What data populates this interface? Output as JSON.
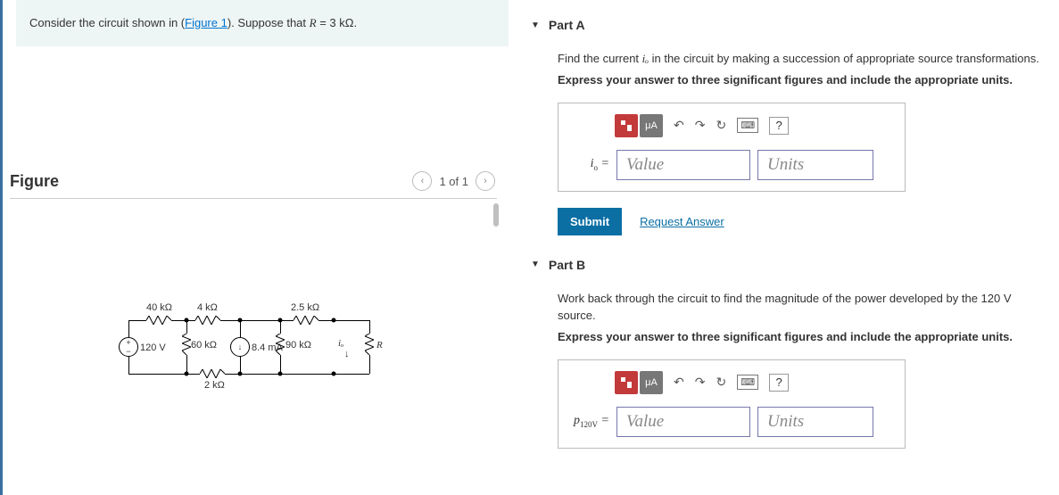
{
  "prompt": {
    "pre": "Consider the circuit shown in (",
    "link": "Figure 1",
    "post": "). Suppose that ",
    "var": "R",
    "eq": " = 3 kΩ."
  },
  "figure": {
    "heading": "Figure",
    "pager": "1 of 1",
    "labels": {
      "r40": "40 kΩ",
      "r4": "4 kΩ",
      "r25": "2.5 kΩ",
      "v120": "120 V",
      "r60": "60 kΩ",
      "i84": "8.4 mA",
      "r90": "90 kΩ",
      "r2": "2 kΩ",
      "io": "iₒ",
      "R": "R"
    }
  },
  "partA": {
    "title": "Part A",
    "line1_pre": "Find the current ",
    "line1_var": "iₒ",
    "line1_post": " in the circuit by making a succession of appropriate source transformations.",
    "line2": "Express your answer to three significant figures and include the appropriate units.",
    "toolbar_unit": "μA",
    "eq_label_html": "iₒ =",
    "value_ph": "Value",
    "units_ph": "Units",
    "submit": "Submit",
    "request": "Request Answer",
    "help": "?"
  },
  "partB": {
    "title": "Part B",
    "line1": "Work back through the circuit to find the magnitude of the power developed by the 120 V source.",
    "line2": "Express your answer to three significant figures and include the appropriate units.",
    "toolbar_unit": "μA",
    "eq_label": "p₁₂₀ᵥ =",
    "value_ph": "Value",
    "units_ph": "Units",
    "help": "?"
  }
}
